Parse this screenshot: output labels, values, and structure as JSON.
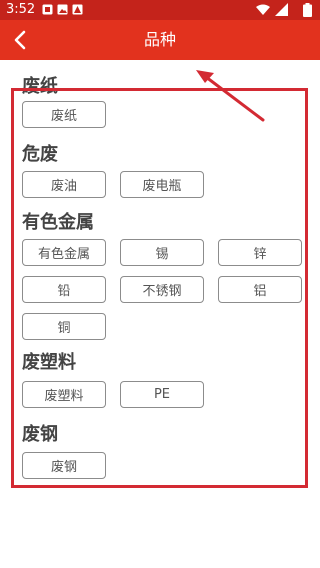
{
  "status_bar": {
    "time": "3:52",
    "icons": [
      "notification-icon",
      "image-icon",
      "app-icon",
      "wifi-icon",
      "signal-icon",
      "battery-icon"
    ]
  },
  "app_bar": {
    "title": "品种",
    "back_icon": "chevron-left-icon"
  },
  "categories": [
    {
      "title": "废纸",
      "items": [
        "废纸"
      ]
    },
    {
      "title": "危废",
      "items": [
        "废油",
        "废电瓶"
      ]
    },
    {
      "title": "有色金属",
      "items": [
        "有色金属",
        "锡",
        "锌",
        "铅",
        "不锈钢",
        "铝",
        "铜"
      ]
    },
    {
      "title": "废塑料",
      "items": [
        "废塑料",
        "PE"
      ]
    },
    {
      "title": "废钢",
      "items": [
        "废钢"
      ]
    }
  ],
  "colors": {
    "status_bar": "#c4231b",
    "app_bar": "#e2321e",
    "highlight": "#d32a33",
    "chip_border": "#8c8c8c"
  }
}
